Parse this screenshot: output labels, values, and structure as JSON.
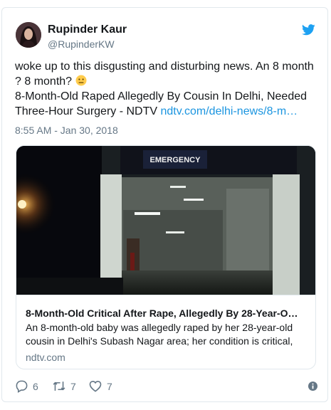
{
  "author": {
    "name": "Rupinder Kaur",
    "handle": "@RupinderKW"
  },
  "tweet": {
    "text_part1": "woke up to this disgusting and disturbing news. An 8 month ? 8 month? ",
    "text_part2": "8-Month-Old Raped Allegedly By Cousin In Delhi, Needed Three-Hour Surgery - NDTV ",
    "link": "ndtv.com/delhi-news/8-m…",
    "emoji": "neutral-face-emoji",
    "timestamp": "8:55 AM - Jan 30, 2018"
  },
  "card": {
    "image_sign_text": "EMERGENCY",
    "title": "8-Month-Old Critical After Rape, Allegedly By 28-Year-O…",
    "description": "An 8-month-old baby was allegedly raped by her 28-year-old cousin in Delhi's Subash Nagar area; her condition is critical,",
    "domain": "ndtv.com"
  },
  "actions": {
    "replies": "6",
    "retweets": "7",
    "likes": "7"
  },
  "colors": {
    "link": "#1b95e0",
    "muted": "#657786",
    "twitter_blue": "#1da1f2"
  }
}
